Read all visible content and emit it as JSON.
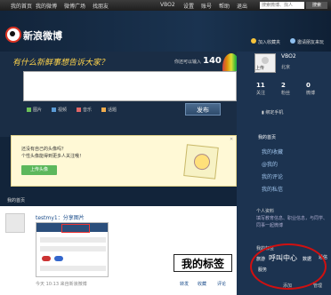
{
  "topnav": {
    "items": [
      "我的首页",
      "我的微博",
      "微博广场",
      "找朋友"
    ],
    "right_items": [
      "VBO2",
      "设置",
      "账号",
      "帮助",
      "退出"
    ],
    "search_placeholder": "搜索微博、找人",
    "search_button": "搜索"
  },
  "header": {
    "logo_text": "新浪微博",
    "links": [
      "加入收藏夹",
      "邀请朋友来玩"
    ]
  },
  "composer": {
    "tagline": "有什么新鲜事想告诉大家？",
    "char_hint": "你还可以输入",
    "char_count": "140",
    "tools": [
      "图片",
      "视频",
      "音乐",
      "话题"
    ],
    "publish": "发布"
  },
  "infobox": {
    "line1": "还没有自己的头像吗？",
    "line2": "个性头像能得到更多人关注哦！",
    "upload": "上传头像",
    "close": "关闭"
  },
  "feed": {
    "label": "我的首页",
    "author": "testmy1：分享图片",
    "callout": "我的标签",
    "meta": "今天 10:13  来自新浪微博",
    "actions": [
      "转发",
      "收藏",
      "评论"
    ]
  },
  "sidebar": {
    "upload_label": "上传",
    "username": "VBO2",
    "location": "北京",
    "stats": [
      {
        "num": "11",
        "label": "关注"
      },
      {
        "num": "2",
        "label": "粉丝"
      },
      {
        "num": "0",
        "label": "微博"
      }
    ],
    "phone": "绑定手机",
    "nav_head": "我的首页",
    "nav_items": [
      "我的收藏",
      "@我的",
      "我的评论",
      "我的私信"
    ],
    "profile_head": "个人资料",
    "profile_desc": "填写教育信息、职业信息，与同学、同事一起微博",
    "tags_head": "我的标签",
    "tags": [
      "旅游",
      "呼叫中心",
      "数据",
      "通信",
      "服务"
    ],
    "add": "添加",
    "manage": "管理"
  }
}
